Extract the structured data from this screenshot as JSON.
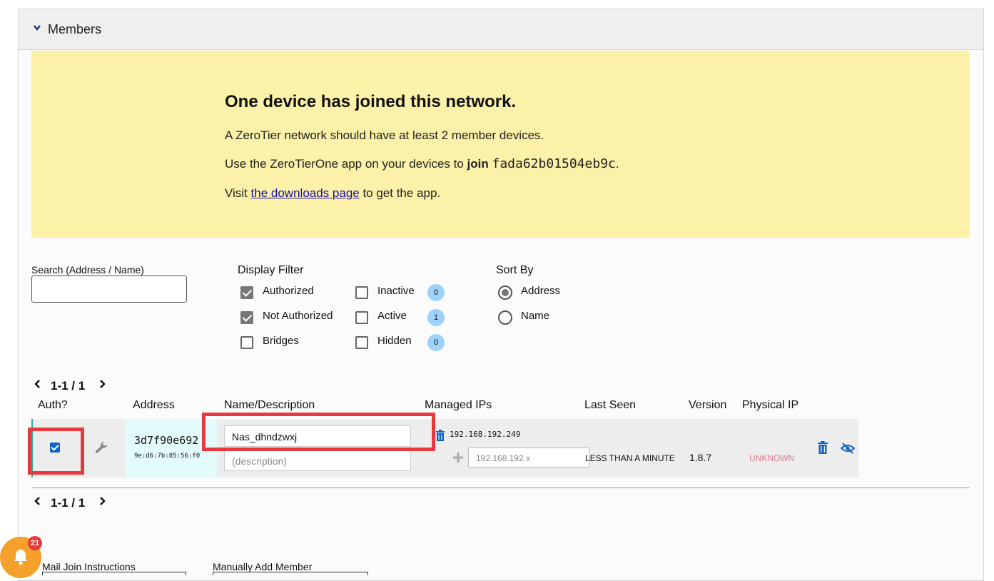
{
  "section": {
    "title": "Members"
  },
  "notice": {
    "heading": "One device has joined this network.",
    "line1": "A ZeroTier network should have at least 2 member devices.",
    "line2_prefix": "Use the ZeroTierOne app on your devices to ",
    "line2_join": "join",
    "line2_network_id": "fada62b01504eb9c",
    "line2_suffix": ".",
    "line3_prefix": "Visit ",
    "line3_link": "the downloads page",
    "line3_suffix": " to get the app."
  },
  "search": {
    "label": "Search (Address / Name)",
    "value": ""
  },
  "display_filter": {
    "title": "Display Filter",
    "authorized": {
      "label": "Authorized",
      "checked": true
    },
    "not_authorized": {
      "label": "Not Authorized",
      "checked": true
    },
    "bridges": {
      "label": "Bridges",
      "checked": false
    },
    "inactive": {
      "label": "Inactive",
      "checked": false,
      "count": "0"
    },
    "active": {
      "label": "Active",
      "checked": false,
      "count": "1"
    },
    "hidden": {
      "label": "Hidden",
      "checked": false,
      "count": "0"
    }
  },
  "sort_by": {
    "title": "Sort By",
    "address": {
      "label": "Address",
      "selected": true
    },
    "name": {
      "label": "Name",
      "selected": false
    }
  },
  "pager": {
    "top": "1-1 / 1",
    "bottom": "1-1 / 1"
  },
  "columns": {
    "auth": "Auth?",
    "address": "Address",
    "name": "Name/Description",
    "managed_ips": "Managed IPs",
    "last_seen": "Last Seen",
    "version": "Version",
    "physical_ip": "Physical IP"
  },
  "member": {
    "authorized": true,
    "address": "3d7f90e692",
    "mac": "9e:d6:7b:85:56:f0",
    "name": "Nas_dhndzwxj",
    "description_placeholder": "(description)",
    "managed_ip": "192.168.192.249",
    "new_ip_placeholder": "192.168.192.x",
    "last_seen": "LESS THAN A MINUTE",
    "version": "1.8.7",
    "physical_ip": "UNKNOWN"
  },
  "footer": {
    "mail_join": "Mail Join Instructions",
    "manual_add": "Manually Add Member"
  },
  "notifications": {
    "count": "21"
  },
  "colors": {
    "notice_bg": "#fbf1a9",
    "highlight": "#e8393f",
    "badge": "#9fd1fb",
    "link": "#1a0dab",
    "unknown": "#e07a8a",
    "icon_blue": "#0b63c5",
    "notify": "#f6a02c"
  }
}
